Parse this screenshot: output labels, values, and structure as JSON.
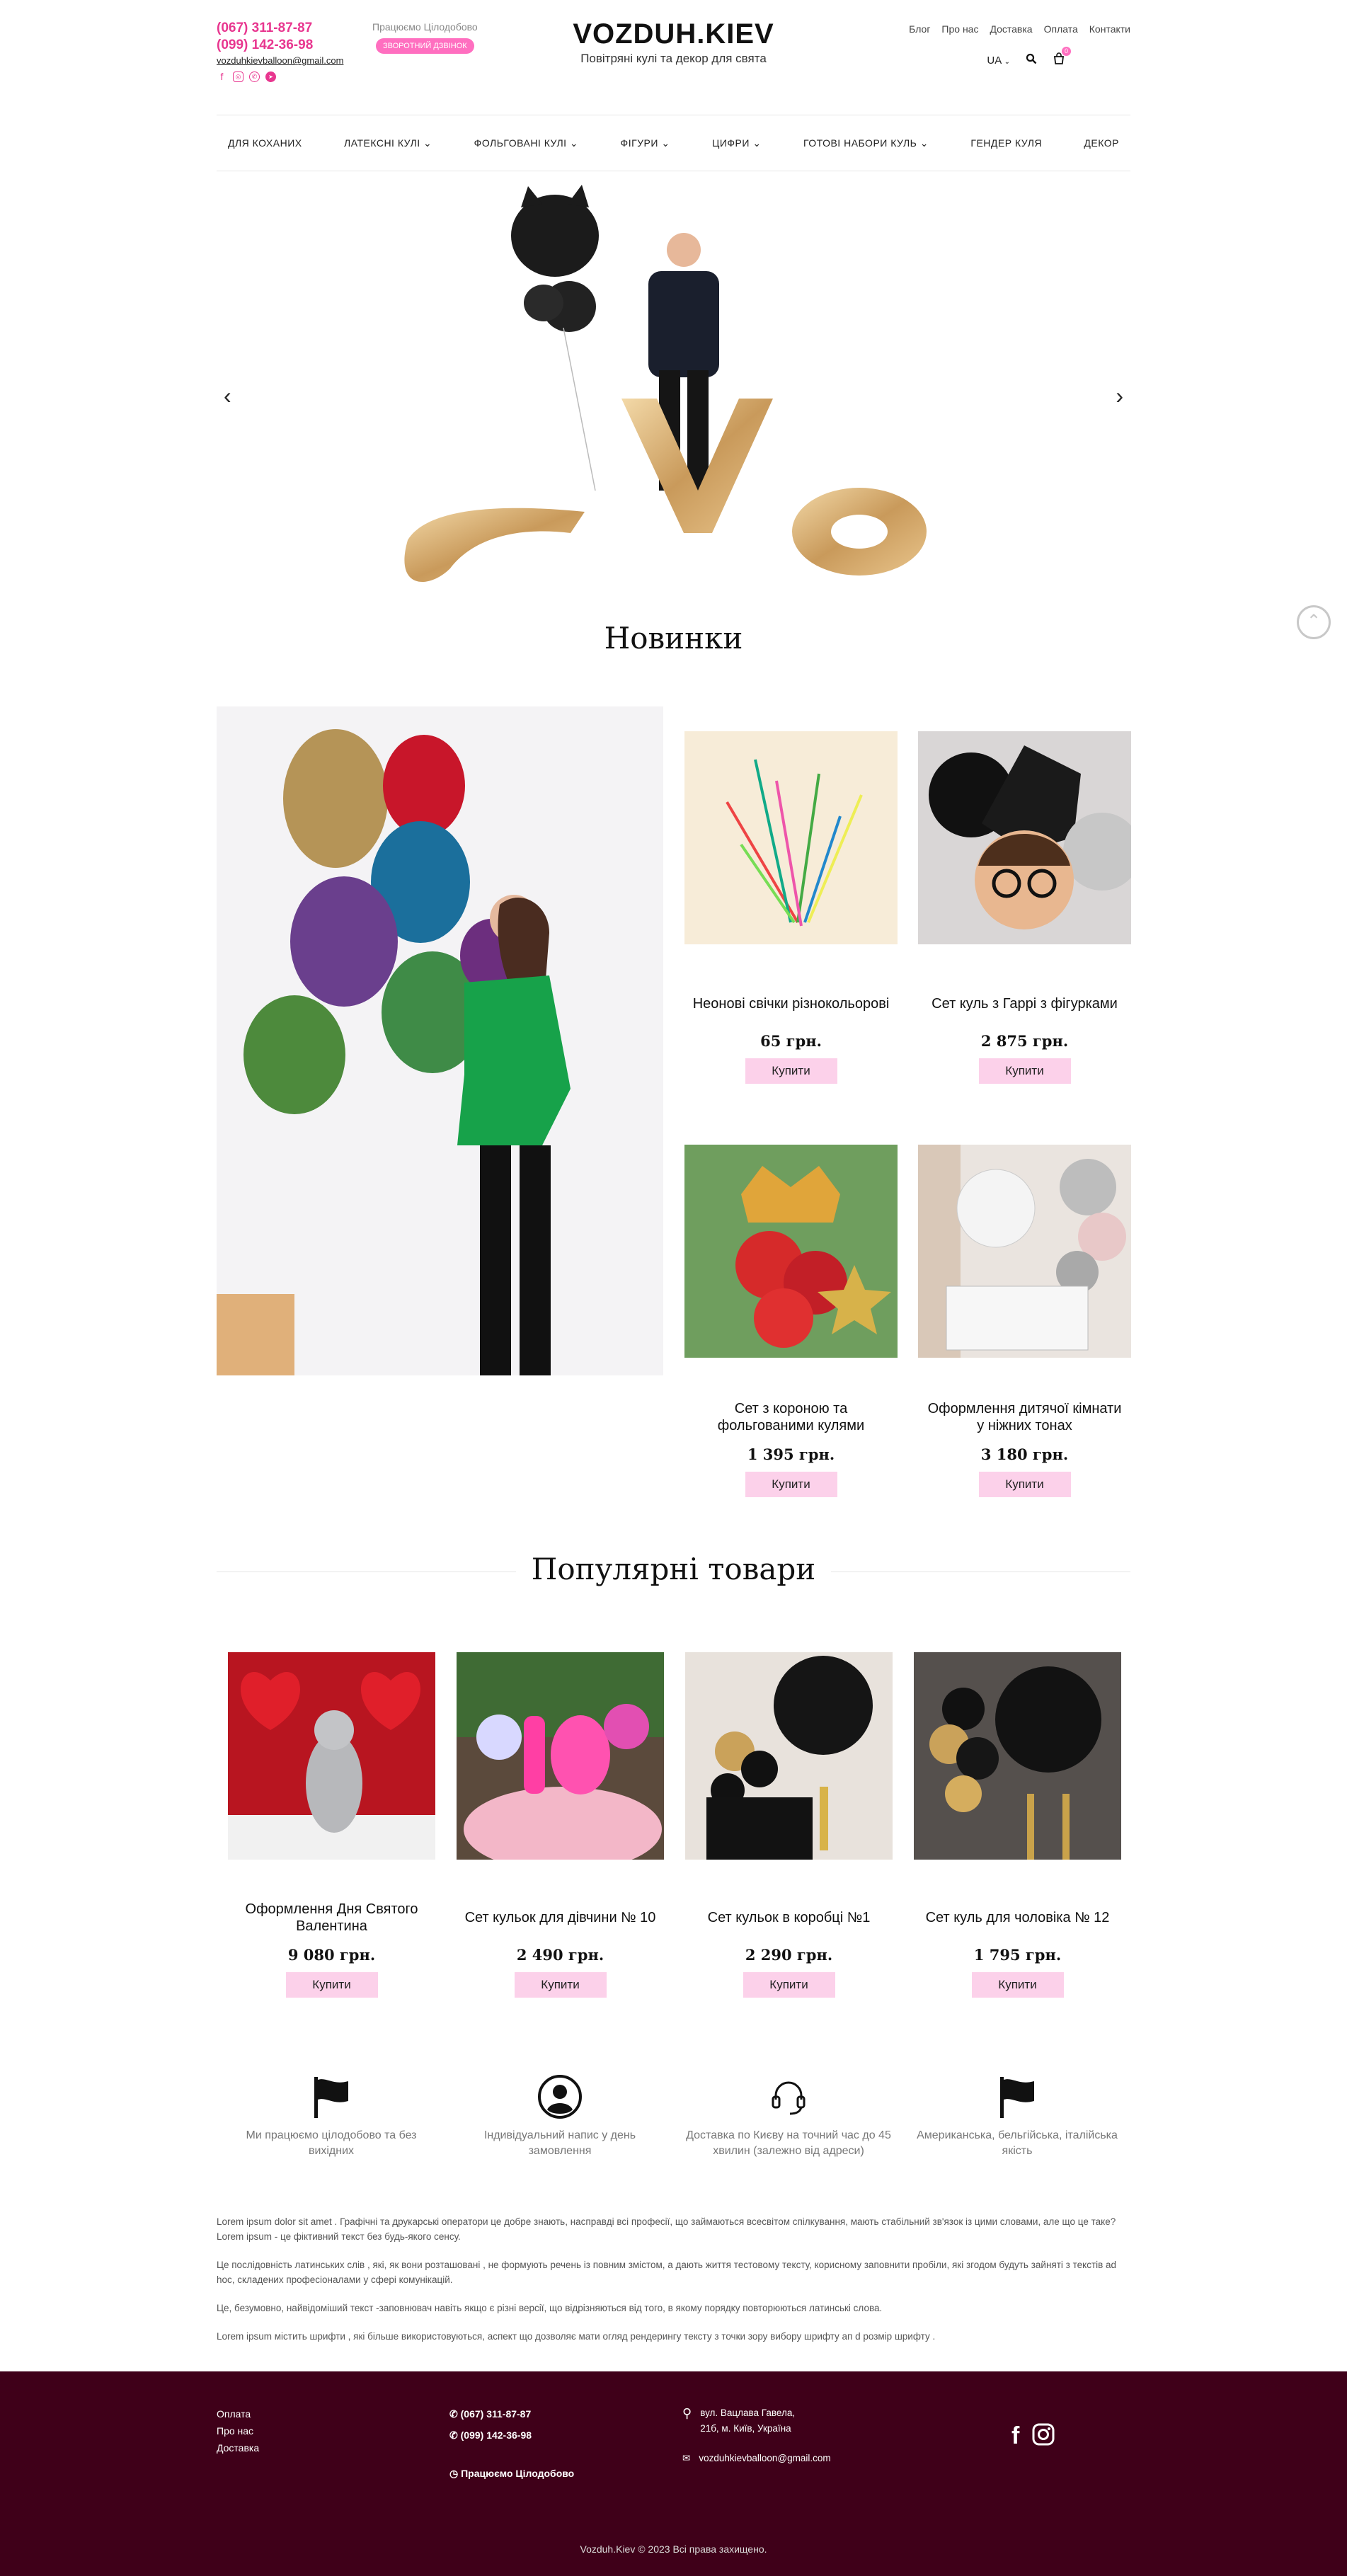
{
  "header": {
    "phone1": "(067) 311-87-87",
    "phone2": "(099) 142-36-98",
    "email": "vozduhkievballoon@gmail.com",
    "hours": "Працюємо Цілодобово",
    "callback_label": "ЗВОРОТНИЙ ДЗВІНОК",
    "logo_title": "VOZDUH.KIEV",
    "logo_subtitle": "Повітряні кулі та декор для свята",
    "top_links": [
      "Блог",
      "Про нас",
      "Доставка",
      "Оплата",
      "Контакти"
    ],
    "language": "UA",
    "cart_count": "0"
  },
  "menu": [
    "ДЛЯ КОХАНИХ",
    "ЛАТЕКСНІ КУЛІ",
    "ФОЛЬГОВАНІ КУЛІ",
    "ФІГУРИ",
    "ЦИФРИ",
    "ГОТОВІ НАБОРИ КУЛЬ",
    "ГЕНДЕР КУЛЯ",
    "ДЕКОР"
  ],
  "new_section": {
    "title": "Новинки",
    "products": [
      {
        "name": "Неонові свічки різнокольорові",
        "price": "65 грн.",
        "buy": "Купити"
      },
      {
        "name": "Сет куль з Гаррі з фігурками",
        "price": "2 875 грн.",
        "buy": "Купити"
      },
      {
        "name": "Сет з короною та фольгованими кулями",
        "price": "1 395 грн.",
        "buy": "Купити"
      },
      {
        "name": "Оформлення дитячої кімнати у ніжних тонах",
        "price": "3 180 грн.",
        "buy": "Купити"
      }
    ]
  },
  "popular_section": {
    "title": "Популярні товари",
    "products": [
      {
        "name": "Оформлення Дня Святого Валентина",
        "price": "9 080 грн.",
        "buy": "Купити"
      },
      {
        "name": "Сет кульок для дівчини № 10",
        "price": "2 490 грн.",
        "buy": "Купити"
      },
      {
        "name": "Сет кульок в коробці №1",
        "price": "2 290 грн.",
        "buy": "Купити"
      },
      {
        "name": "Сет куль для чоловіка № 12",
        "price": "1 795 грн.",
        "buy": "Купити"
      }
    ]
  },
  "features": [
    {
      "icon": "flag-icon",
      "text": "Ми працюємо цілодобово та без вихідних"
    },
    {
      "icon": "user-circle-icon",
      "text": "Індивідуальний напис у день замовлення"
    },
    {
      "icon": "headset-icon",
      "text": "Доставка по Києву на точний час до 45 хвилин (залежно від адреси)"
    },
    {
      "icon": "flag-icon",
      "text": "Американська, бельгійська, італійська якість"
    }
  ],
  "lorem": [
    "Lorem ipsum dolor sit amet . Графічні та друкарські оператори це добре знають, насправді всі професії, що займаються всесвітом спілкування, мають стабільний зв'язок із цими словами, але що це таке? Lorem ipsum - це фіктивний текст без будь-якого сенсу.",
    "Це послідовність латинських слів , які, як вони розташовані , не формують речень із повним змістом, а дають життя тестовому тексту, корисному заповнити пробіли, які згодом будуть зайняті з текстів ad hoc, складених професіоналами у сфері комунікацій.",
    "Це, безумовно, найвідоміший текст -заповнювач навіть якщо є різні версії, що відрізняються від того, в якому порядку повторюються латинські слова.",
    "Lorem ipsum містить шрифти , які більше використовуються, аспект що дозволяє мати огляд рендерингу тексту з точки зору вибору шрифту ап d розмір шрифту ."
  ],
  "footer": {
    "links": [
      "Оплата",
      "Про нас",
      "Доставка"
    ],
    "phone1": "(067) 311-87-87",
    "phone2": "(099) 142-36-98",
    "hours": "Працюємо Цілодобово",
    "address_line1": "вул. Вацлава Гавела,",
    "address_line2": "21б, м. Київ, Україна",
    "email": "vozduhkievballoon@gmail.com",
    "copyright": "Vozduh.Kiev © 2023 Всі права захищено."
  },
  "colors": {
    "accent_pink": "#e8368f",
    "button_pink": "#fcd1ea",
    "footer_bg": "#3f0019"
  }
}
